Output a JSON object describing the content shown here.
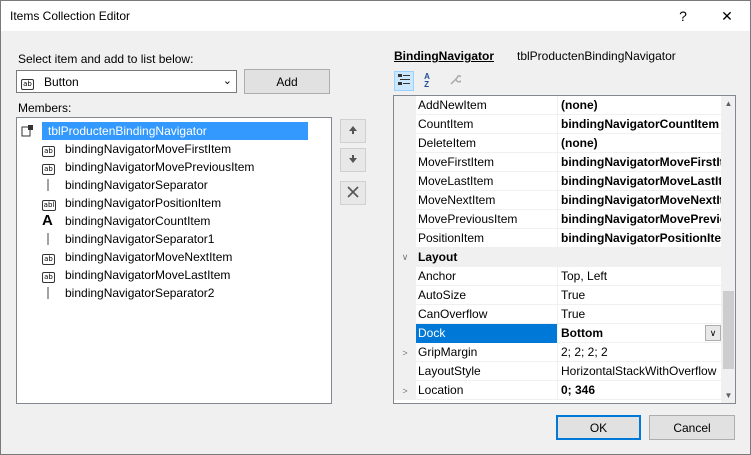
{
  "window": {
    "title": "Items Collection Editor",
    "help": "?",
    "close": "✕"
  },
  "left": {
    "select_label": "Select item and add to list below:",
    "combo_value": "Button",
    "add_label": "Add",
    "members_label": "Members:",
    "members": [
      {
        "label": "tblProductenBindingNavigator",
        "icon": "navigator-icon"
      },
      {
        "label": "bindingNavigatorMoveFirstItem",
        "icon": "button-icon"
      },
      {
        "label": "bindingNavigatorMovePreviousItem",
        "icon": "button-icon"
      },
      {
        "label": "bindingNavigatorSeparator",
        "icon": "separator-icon"
      },
      {
        "label": "bindingNavigatorPositionItem",
        "icon": "textbox-icon"
      },
      {
        "label": "bindingNavigatorCountItem",
        "icon": "label-icon"
      },
      {
        "label": "bindingNavigatorSeparator1",
        "icon": "separator-icon"
      },
      {
        "label": "bindingNavigatorMoveNextItem",
        "icon": "button-icon"
      },
      {
        "label": "bindingNavigatorMoveLastItem",
        "icon": "button-icon"
      },
      {
        "label": "bindingNavigatorSeparator2",
        "icon": "separator-icon"
      }
    ]
  },
  "right": {
    "object_type": "BindingNavigator",
    "object_name": "tblProductenBindingNavigator",
    "rows": [
      {
        "name": "AddNewItem",
        "value": "(none)"
      },
      {
        "name": "CountItem",
        "value": "bindingNavigatorCountItem"
      },
      {
        "name": "DeleteItem",
        "value": "(none)"
      },
      {
        "name": "MoveFirstItem",
        "value": "bindingNavigatorMoveFirstItem"
      },
      {
        "name": "MoveLastItem",
        "value": "bindingNavigatorMoveLastItem"
      },
      {
        "name": "MoveNextItem",
        "value": "bindingNavigatorMoveNextItem"
      },
      {
        "name": "MovePreviousItem",
        "value": "bindingNavigatorMovePreviousItem"
      },
      {
        "name": "PositionItem",
        "value": "bindingNavigatorPositionItem"
      },
      {
        "name": "Layout",
        "value": ""
      },
      {
        "name": "Anchor",
        "value": "Top, Left"
      },
      {
        "name": "AutoSize",
        "value": "True"
      },
      {
        "name": "CanOverflow",
        "value": "True"
      },
      {
        "name": "Dock",
        "value": "Bottom"
      },
      {
        "name": "GripMargin",
        "value": "2; 2; 2; 2"
      },
      {
        "name": "LayoutStyle",
        "value": "HorizontalStackWithOverflow"
      },
      {
        "name": "Location",
        "value": "0; 346"
      }
    ]
  },
  "footer": {
    "ok_label": "OK",
    "cancel_label": "Cancel"
  },
  "colors": {
    "selection": "#3399ff",
    "accent": "#0078d7"
  }
}
